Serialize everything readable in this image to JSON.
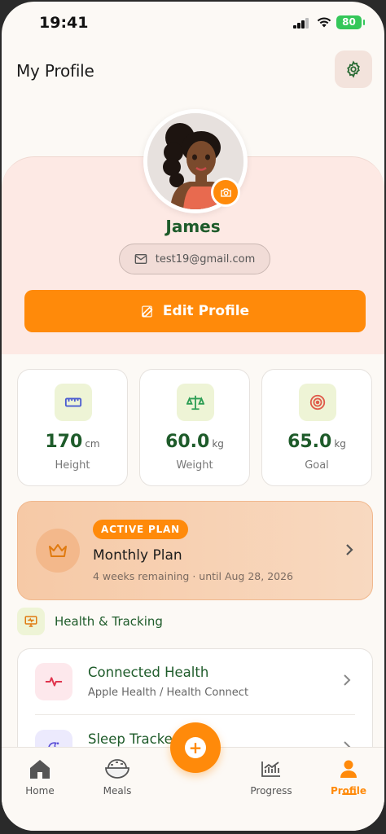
{
  "status_bar": {
    "time": "19:41",
    "battery": "80"
  },
  "header": {
    "title": "My Profile"
  },
  "profile": {
    "name": "James",
    "email": "test19@gmail.com",
    "edit_label": "Edit Profile"
  },
  "stats": [
    {
      "value": "170",
      "unit": "cm",
      "label": "Height",
      "icon": "ruler-icon"
    },
    {
      "value": "60.0",
      "unit": "kg",
      "label": "Weight",
      "icon": "scale-icon"
    },
    {
      "value": "65.0",
      "unit": "kg",
      "label": "Goal",
      "icon": "target-icon"
    }
  ],
  "plan": {
    "badge": "ACTIVE PLAN",
    "name": "Monthly Plan",
    "subtitle": "4 weeks remaining · until Aug 28, 2026"
  },
  "health_section": {
    "title": "Health & Tracking",
    "items": [
      {
        "title": "Connected Health",
        "subtitle": "Apple Health / Health Connect",
        "icon": "heartbeat-icon"
      },
      {
        "title": "Sleep Tracker",
        "subtitle": "",
        "icon": "sleep-icon"
      }
    ]
  },
  "nav": {
    "items": [
      {
        "label": "Home",
        "icon": "home-icon"
      },
      {
        "label": "Meals",
        "icon": "bowl-icon"
      },
      {
        "label": "Progress",
        "icon": "chart-icon"
      },
      {
        "label": "Profile",
        "icon": "person-icon",
        "active": true
      }
    ],
    "fab_label": "+"
  },
  "colors": {
    "accent": "#ff8a0a",
    "primary_text": "#1e5b2a",
    "hero_bg": "#fde9e4"
  }
}
